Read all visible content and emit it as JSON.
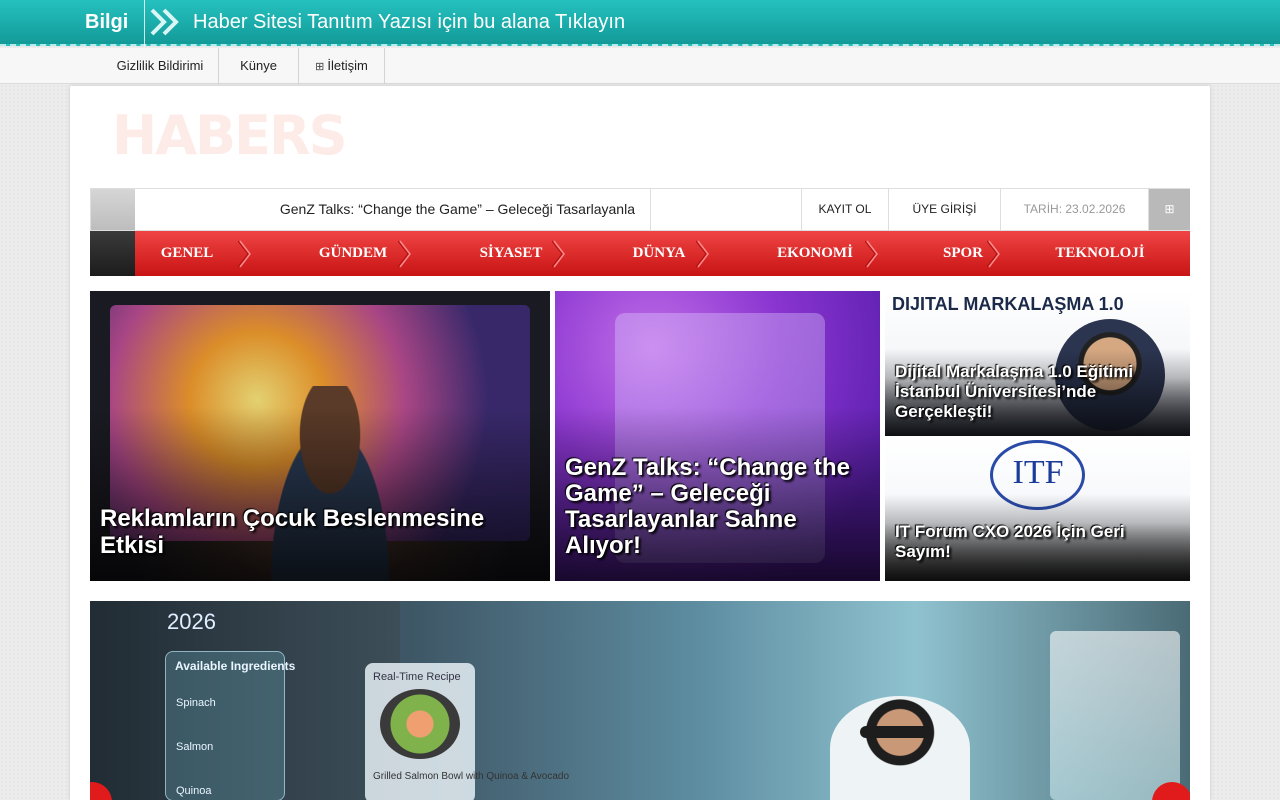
{
  "topbar": {
    "label": "Bilgi",
    "ticker": "Haber Sitesi Tanıtım Yazısı için bu alana Tıklayın"
  },
  "subnav": {
    "items": [
      {
        "label": "Gizlilik Bildirimi"
      },
      {
        "label": "Künye"
      },
      {
        "label": "İletişim",
        "icon": "grid-icon"
      }
    ]
  },
  "logo": {
    "text": "HABERS"
  },
  "inforow": {
    "headline": "GenZ Talks: “Change the Game” – Geleceği Tasarlayanla",
    "register": "KAYIT OL",
    "login": "ÜYE GİRİŞİ",
    "date": "TARİH: 23.02.2026",
    "grid_icon": "grid-icon"
  },
  "categories": [
    {
      "label": "GENEL"
    },
    {
      "label": "GÜNDEM"
    },
    {
      "label": "SİYASET"
    },
    {
      "label": "DÜNYA"
    },
    {
      "label": "EKONOMİ"
    },
    {
      "label": "SPOR"
    },
    {
      "label": "TEKNOLOJİ"
    }
  ],
  "features": [
    {
      "title": "Reklamların Çocuk Beslenmesine Etkisi"
    },
    {
      "title": "GenZ Talks: “Change the Game” – Geleceği Tasarlayanlar Sahne Alıyor!"
    },
    {
      "title": "Dijital Markalaşma 1.0 Eğitimi İstanbul Üniversitesi’nde Gerçekleşti!",
      "image_heading": "DIJITAL MARKALAŞMA 1.0"
    },
    {
      "title": "IT Forum CXO 2026 İçin Geri Sayım!",
      "image_logo": "ITF"
    }
  ],
  "slider": {
    "year": "2026",
    "available": "Available Ingredients",
    "ingredients": [
      "Spinach",
      "Salmon",
      "Quinoa"
    ],
    "recipe_heading": "Real-Time Recipe",
    "recipe_name": "Grilled Salmon Bowl with Quinoa & Avocado"
  },
  "colors": {
    "topbar": "#1aaeac",
    "menu_red": "#e32626",
    "text_dark": "#222222"
  }
}
